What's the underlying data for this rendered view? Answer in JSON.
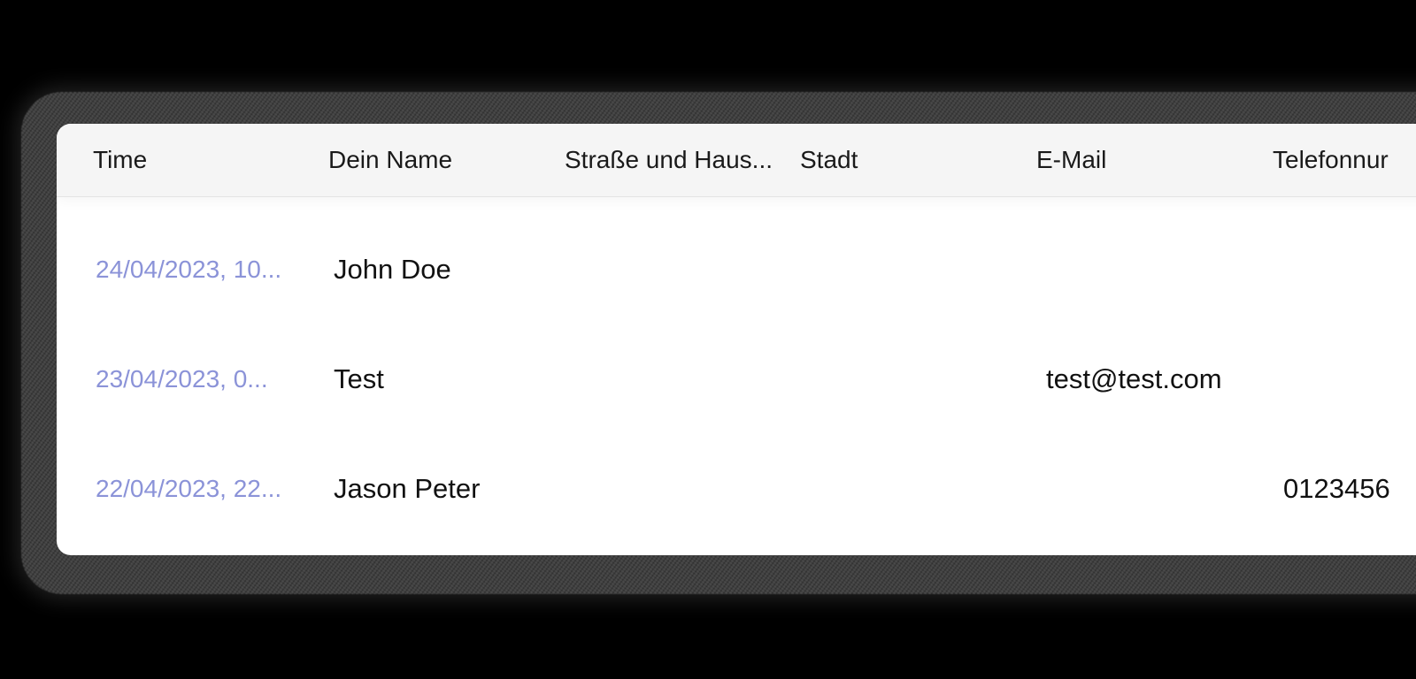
{
  "table": {
    "columns": [
      {
        "label": "Time"
      },
      {
        "label": "Dein Name"
      },
      {
        "label": "Straße und Haus..."
      },
      {
        "label": "Stadt"
      },
      {
        "label": "E-Mail"
      },
      {
        "label": "Telefonnur"
      }
    ],
    "rows": [
      {
        "time": "24/04/2023, 10...",
        "name": "John Doe",
        "street": "",
        "city": "",
        "email": "",
        "phone": ""
      },
      {
        "time": "23/04/2023, 0...",
        "name": "Test",
        "street": "",
        "city": "",
        "email": "test@test.com",
        "phone": ""
      },
      {
        "time": "22/04/2023, 22...",
        "name": "Jason Peter",
        "street": "",
        "city": "",
        "email": "",
        "phone": "0123456"
      }
    ],
    "colors": {
      "time_link": "#8b93d8",
      "header_bg": "#f5f5f5",
      "card_bg": "#ffffff"
    }
  }
}
